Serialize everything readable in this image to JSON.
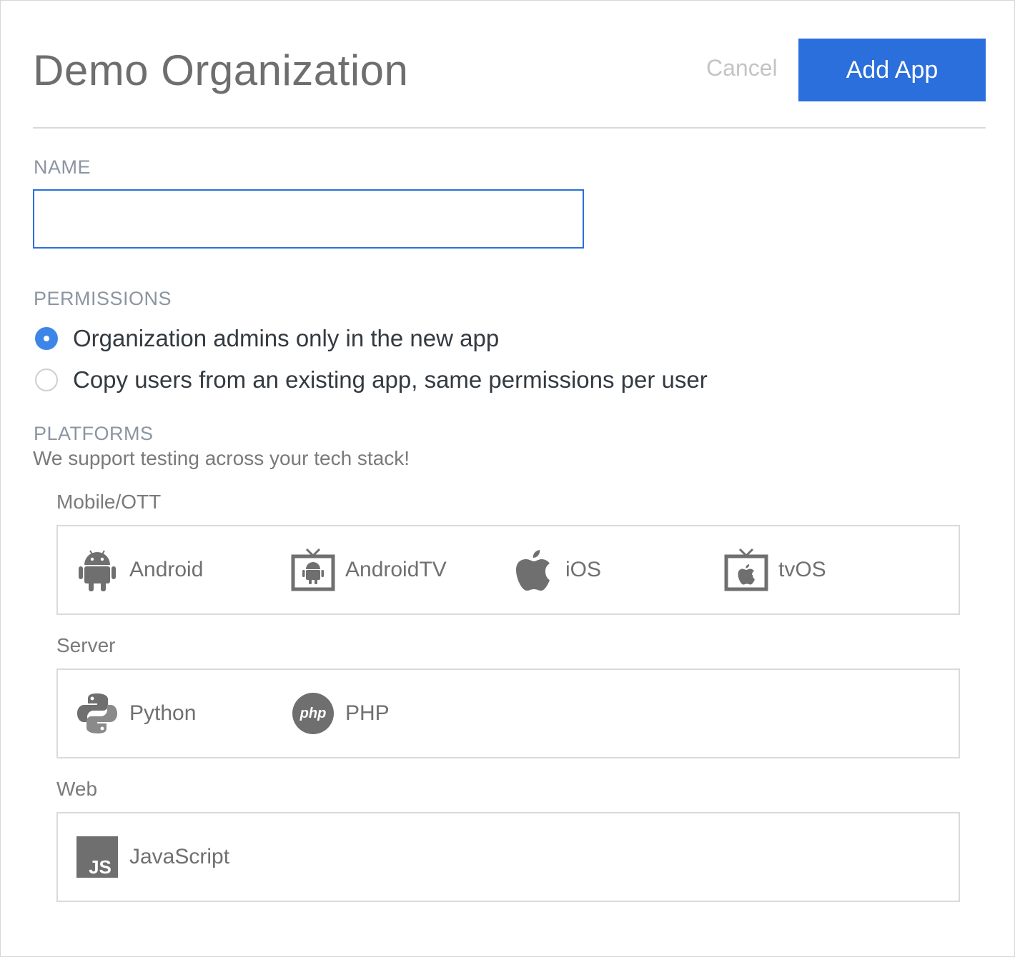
{
  "header": {
    "title": "Demo Organization",
    "cancel_label": "Cancel",
    "add_label": "Add App",
    "accent_color": "#2a6fdb"
  },
  "name_section": {
    "label": "NAME",
    "value": "",
    "placeholder": ""
  },
  "permissions": {
    "label": "PERMISSIONS",
    "options": [
      {
        "label": "Organization admins only in the new app",
        "checked": true
      },
      {
        "label": "Copy users from an existing app, same permissions per user",
        "checked": false
      }
    ]
  },
  "platforms": {
    "label": "PLATFORMS",
    "subtext": "We support testing across your tech stack!",
    "groups": [
      {
        "name": "Mobile/OTT",
        "items": [
          {
            "label": "Android",
            "icon": "android-icon"
          },
          {
            "label": "AndroidTV",
            "icon": "android-tv-icon"
          },
          {
            "label": "iOS",
            "icon": "apple-icon"
          },
          {
            "label": "tvOS",
            "icon": "apple-tv-icon"
          }
        ]
      },
      {
        "name": "Server",
        "items": [
          {
            "label": "Python",
            "icon": "python-icon"
          },
          {
            "label": "PHP",
            "icon": "php-icon"
          }
        ]
      },
      {
        "name": "Web",
        "items": [
          {
            "label": "JavaScript",
            "icon": "javascript-icon"
          }
        ]
      }
    ]
  }
}
